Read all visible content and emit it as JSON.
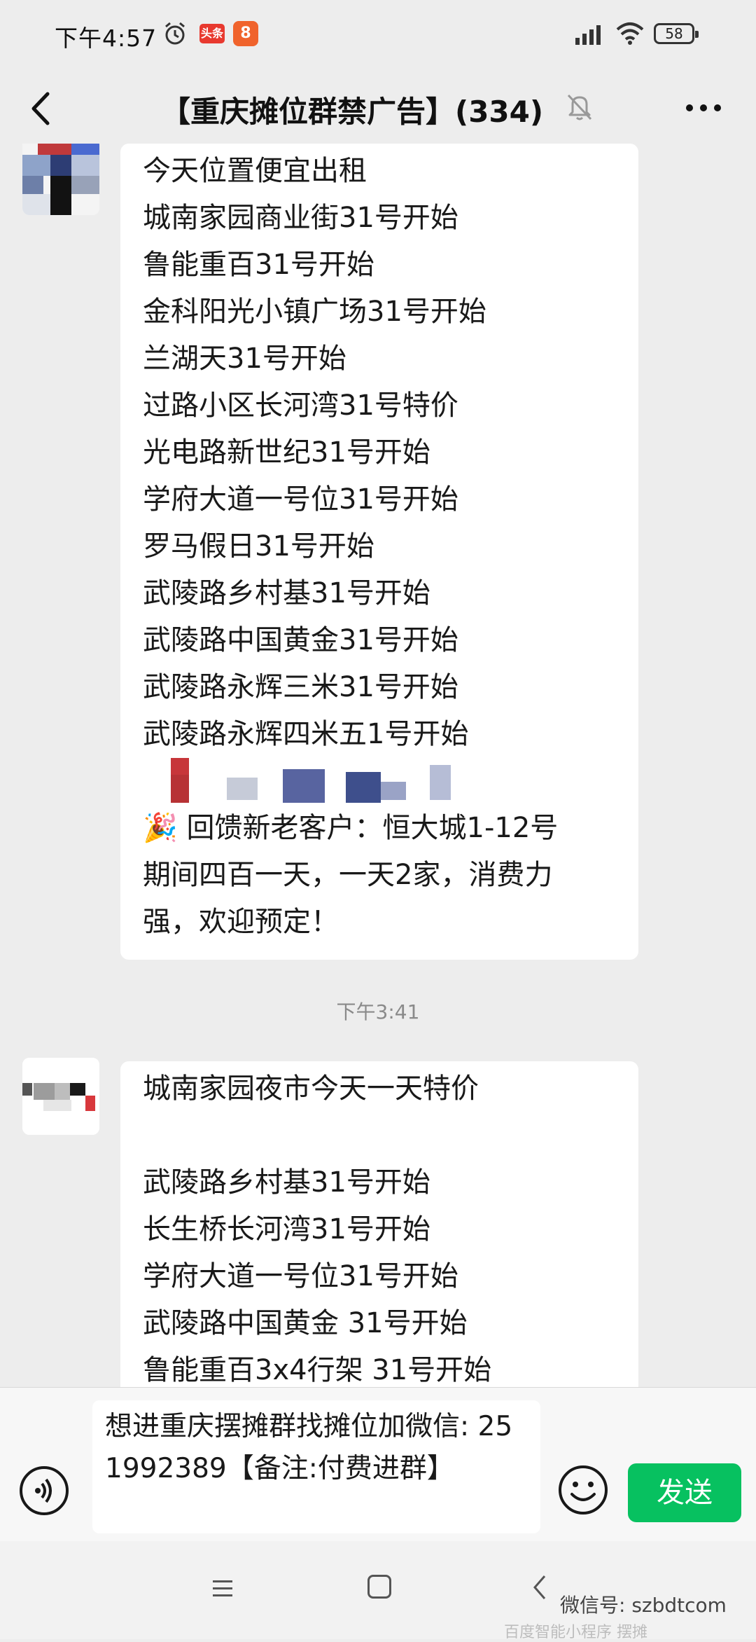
{
  "status_bar": {
    "time": "下午4:57",
    "app1_label": "头条",
    "app2_label": "8",
    "battery": "58"
  },
  "header": {
    "title": "【重庆摊位群禁广告】(334)"
  },
  "messages": [
    {
      "lines_before_blur": [
        "今天位置便宜出租",
        "城南家园商业街31号开始",
        "鲁能重百31号开始",
        "金科阳光小镇广场31号开始",
        "兰湖天31号开始",
        "过路小区长河湾31号特价",
        "光电路新世纪31号开始",
        "学府大道一号位31号开始",
        "罗马假日31号开始",
        "武陵路乡村基31号开始",
        "武陵路中国黄金31号开始",
        "武陵路永辉三米31号开始",
        "武陵路永辉四米五1号开始"
      ],
      "lines_after_blur": [
        "🎉 回馈新老客户：恒大城1-12号",
        "期间四百一天，一天2家，消费力",
        "强，欢迎预定！"
      ]
    },
    {
      "timestamp": "下午3:41",
      "lines": [
        "城南家园夜市今天一天特价",
        "",
        "武陵路乡村基31号开始",
        "长生桥长河湾31号开始",
        "学府大道一号位31号开始",
        "武陵路中国黄金 31号开始",
        "鲁能重百3x4行架 31号开始"
      ]
    }
  ],
  "input": {
    "value": "想进重庆摆摊群找摊位加微信: 251992389【备注:付费进群】",
    "send_label": "发送"
  },
  "watermark": {
    "text": "微信号: szbdtcom",
    "bg_text": "百度智能小程序 摆摊"
  },
  "colors": {
    "accent": "#07c160",
    "background": "#ededed",
    "bubble": "#ffffff"
  }
}
